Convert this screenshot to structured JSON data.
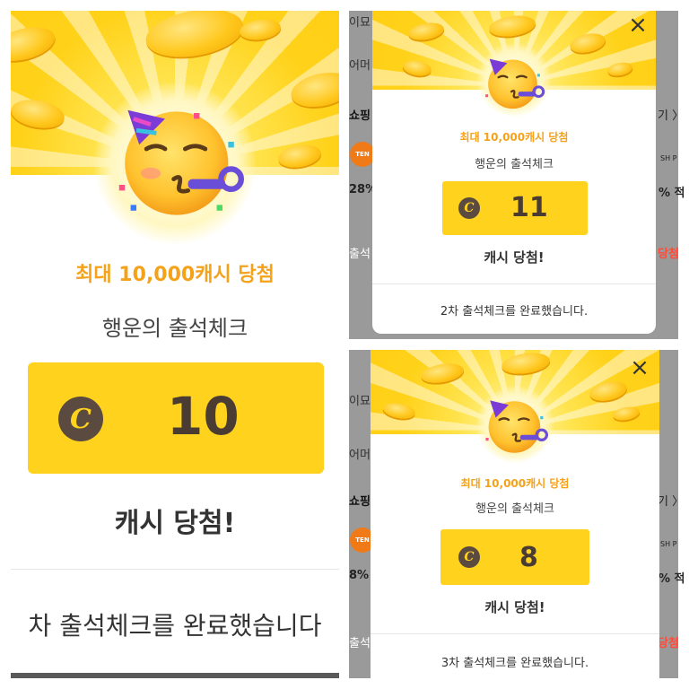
{
  "collage": {
    "panels": [
      {
        "id": "large",
        "title": "최대 10,000캐시 당첨",
        "subtitle": "행운의 출석체크",
        "amount": "10",
        "won": "캐시 당첨!",
        "completed": "차 출석체크를 완료했습니다"
      },
      {
        "id": "top-right",
        "title": "최대 10,000캐시 당첨",
        "subtitle": "행운의 출석체크",
        "amount": "11",
        "won": "캐시 당첨!",
        "completed": "2차 출석체크를 완료했습니다.",
        "close": "×"
      },
      {
        "id": "bottom-right",
        "title": "최대 10,000캐시 당첨",
        "subtitle": "행운의 출석체크",
        "amount": "8",
        "won": "캐시 당첨!",
        "completed": "3차 출석체크를 완료했습니다.",
        "close": "×"
      }
    ],
    "coin_symbol": "C",
    "background_app": {
      "left_labels_top": [
        "이묘",
        "어머",
        "쇼핑"
      ],
      "left_labels_bottom": [
        "이묘",
        "어머",
        "쇼핑"
      ],
      "percent_left": "28%",
      "percent_left_bottom": "8%",
      "right_percent": "% 적",
      "right_tag_top": "당첨",
      "right_tag_bottom": "당첨",
      "more_chevron": "기 〉",
      "attend_label": "출석",
      "logo_text": "TEN",
      "shop_label": "SH P"
    }
  },
  "colors": {
    "accent_yellow": "#ffd21e",
    "title_orange": "#f5a21b",
    "coin_brown": "#5b4a3f"
  }
}
